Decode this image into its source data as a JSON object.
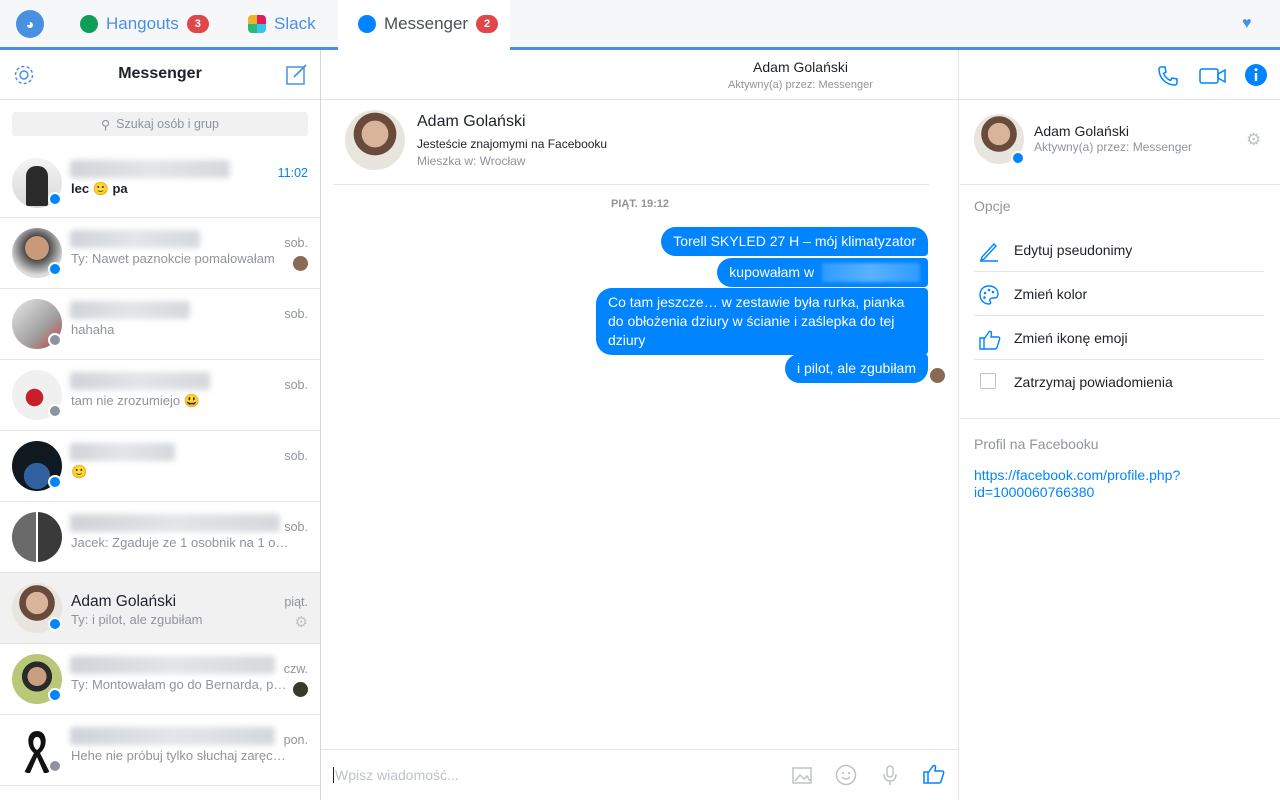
{
  "app": {
    "tabs": [
      {
        "label": "Hangouts",
        "badge": "3"
      },
      {
        "label": "Slack",
        "badge": ""
      },
      {
        "label": "Messenger",
        "badge": "2"
      }
    ]
  },
  "sidebar": {
    "title": "Messenger",
    "search_placeholder": "Szukaj osób i grup",
    "conversations": [
      {
        "name": "",
        "message": "lec 🙂 pa",
        "time": "11:02",
        "unread": true,
        "badge": "messenger"
      },
      {
        "name": "",
        "message": "Ty: Nawet paznokcie pomalowałam",
        "time": "sob.",
        "badge": "messenger"
      },
      {
        "name": "",
        "message": "hahaha",
        "time": "sob.",
        "badge": "facebook"
      },
      {
        "name": "",
        "message": "tam nie zrozumiejo 😃",
        "time": "sob.",
        "badge": "facebook"
      },
      {
        "name": "",
        "message": "🙂",
        "time": "sob.",
        "badge": "messenger"
      },
      {
        "name": "",
        "message": "Jacek: Zgaduje ze 1 osobnik na 1 o…",
        "time": "sob.",
        "badge": ""
      },
      {
        "name": "Adam Golański",
        "message": "Ty: i pilot, ale zgubiłam",
        "time": "piąt.",
        "badge": "messenger",
        "selected": true
      },
      {
        "name": "",
        "message": "Ty: Montowałam go do Bernarda, p…",
        "time": "czw.",
        "badge": "messenger"
      },
      {
        "name": "",
        "message": "Hehe nie próbuj tylko słuchaj zaręc…",
        "time": "pon.",
        "badge": "facebook"
      }
    ]
  },
  "chat": {
    "header_name": "Adam Golański",
    "header_status": "Aktywny(a) przez: Messenger",
    "profile": {
      "name": "Adam Golański",
      "friends": "Jesteście znajomymi na Facebooku",
      "lives": "Mieszka w: Wrocław"
    },
    "day_label": "PIĄT. 19:12",
    "messages": [
      "Torell SKYLED 27 H – mój klimatyzator",
      "kupowałam w",
      "Co tam jeszcze… w zestawie była rurka, pianka do obłożenia dziury w ścianie i zaślepka do tej dziury",
      "i pilot, ale zgubiłam"
    ],
    "composer_placeholder": "Wpisz wiadomość..."
  },
  "details": {
    "name": "Adam Golański",
    "status": "Aktywny(a) przez: Messenger",
    "options_label": "Opcje",
    "options": [
      "Edytuj pseudonimy",
      "Zmień kolor",
      "Zmień ikonę emoji",
      "Zatrzymaj powiadomienia"
    ],
    "profile_label": "Profil na Facebooku",
    "profile_link": "https://facebook.com/profile.php?id=1000060766380"
  },
  "colors": {
    "accent": "#0084ff",
    "tab_accent": "#4a90e2",
    "badge": "#e0474c"
  }
}
